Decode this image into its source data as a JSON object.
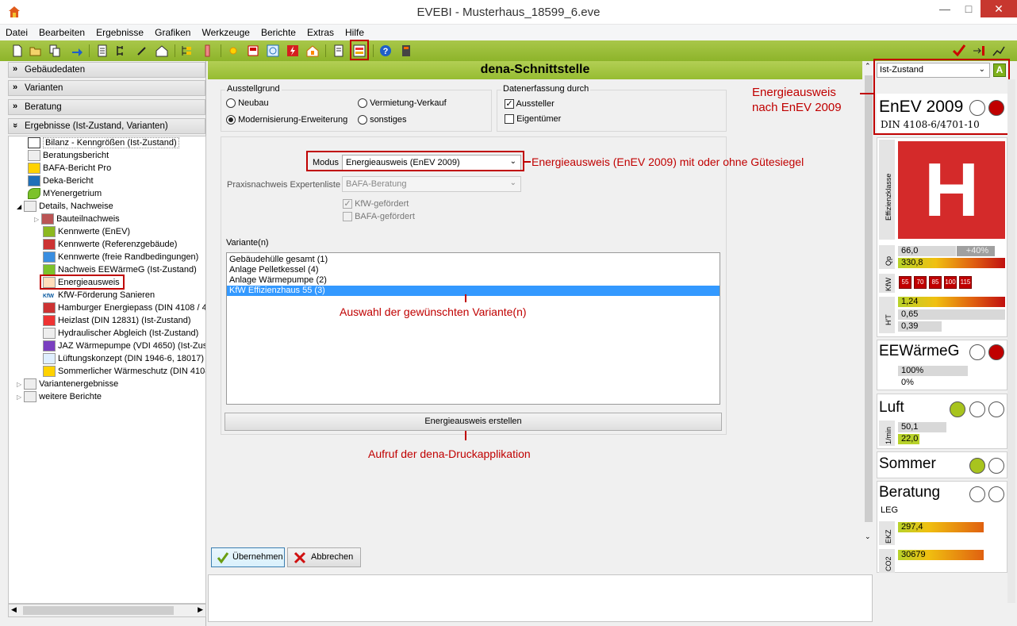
{
  "window": {
    "title": "EVEBI - Musterhaus_18599_6.eve"
  },
  "menu": [
    "Datei",
    "Bearbeiten",
    "Ergebnisse",
    "Grafiken",
    "Werkzeuge",
    "Berichte",
    "Extras",
    "Hilfe"
  ],
  "accordion": [
    {
      "label": "Gebäudedaten",
      "chev": "»"
    },
    {
      "label": "Varianten",
      "chev": "»"
    },
    {
      "label": "Beratung",
      "chev": "»"
    },
    {
      "label": "Ergebnisse (Ist-Zustand, Varianten)",
      "chev": "»"
    }
  ],
  "tree": [
    {
      "label": "Bilanz - Kenngrößen (Ist-Zustand)"
    },
    {
      "label": "Beratungsbericht"
    },
    {
      "label": "BAFA-Bericht Pro"
    },
    {
      "label": "Deka-Bericht"
    },
    {
      "label": "MYenergetrium"
    },
    {
      "label": "Details, Nachweise"
    },
    {
      "label": "Bauteilnachweis"
    },
    {
      "label": "Kennwerte (EnEV)"
    },
    {
      "label": "Kennwerte (Referenzgebäude)"
    },
    {
      "label": "Kennwerte (freie Randbedingungen)"
    },
    {
      "label": "Nachweis EEWärmeG (Ist-Zustand)"
    },
    {
      "label": "Energieausweis"
    },
    {
      "label": "KfW-Förderung Sanieren"
    },
    {
      "label": "Hamburger Energiepass (DIN 4108 / 4"
    },
    {
      "label": "Heizlast (DIN 12831) (Ist-Zustand)"
    },
    {
      "label": "Hydraulischer Abgleich (Ist-Zustand)"
    },
    {
      "label": "JAZ Wärmepumpe (VDI 4650) (Ist-Zus"
    },
    {
      "label": "Lüftungskonzept (DIN 1946-6, 18017)"
    },
    {
      "label": "Sommerlicher Wärmeschutz (DIN 4108"
    },
    {
      "label": "Variantenergebnisse"
    },
    {
      "label": "weitere Berichte"
    }
  ],
  "center": {
    "title": "dena-Schnittstelle",
    "ausstellgrund": {
      "label": "Ausstellgrund",
      "options": [
        "Neubau",
        "Vermietung-Verkauf",
        "Modernisierung-Erweiterung",
        "sonstiges"
      ],
      "selected": "Modernisierung-Erweiterung"
    },
    "datenerfassung": {
      "label": "Datenerfassung durch",
      "options": [
        {
          "label": "Aussteller",
          "checked": true
        },
        {
          "label": "Eigentümer",
          "checked": false
        }
      ]
    },
    "modus": {
      "label": "Modus",
      "value": "Energieausweis (EnEV 2009)"
    },
    "praxis": {
      "label": "Praxisnachweis Expertenliste",
      "value": "BAFA-Beratung"
    },
    "kfw_gefoerdert": "KfW-gefördert",
    "bafa_gefoerdert": "BAFA-gefördert",
    "varianten_label": "Variante(n)",
    "varianten": [
      "Gebäudehülle gesamt (1)",
      "Anlage Pelletkessel (4)",
      "Anlage Wärmepumpe (2)",
      "KfW Effizienzhaus 55 (3)"
    ],
    "selected_variant": "KfW Effizienzhaus 55 (3)",
    "create_button": "Energieausweis erstellen",
    "ok_button": "Übernehmen",
    "cancel_button": "Abbrechen"
  },
  "annotations": {
    "modus": "Energieausweis (EnEV 2009) mit oder ohne Gütesiegel",
    "variante": "Auswahl der gewünschten Variante(n)",
    "druck": "Aufruf der dena-Druckapplikation",
    "enev_line1": "Energieausweis",
    "enev_line2": "nach EnEV 2009"
  },
  "right": {
    "state_select": "Ist-Zustand",
    "state_badge": "A",
    "enev_title": "EnEV 2009",
    "enev_sub": "DIN 4108-6/4701-10",
    "effizienzklasse_label": "Effizienzklasse",
    "effizienzklasse": "H",
    "qp_label": "Qp",
    "qp_values": [
      "66,0",
      "+40%",
      "330,8"
    ],
    "kfw_label": "KfW",
    "kfw_levels": [
      "55",
      "70",
      "85",
      "100",
      "115"
    ],
    "ht_label": "H'T",
    "ht_values": [
      "1,24",
      "0,65",
      "0,39"
    ],
    "eewg_title": "EEWärmeG",
    "eewg_values": [
      "100%",
      "0%"
    ],
    "luft_title": "Luft",
    "luft_label": "1/min",
    "luft_values": [
      "50,1",
      "22,0"
    ],
    "sommer_title": "Sommer",
    "beratung_title": "Beratung",
    "beratung_sub": "LEG",
    "ekz_label": "EKZ",
    "ekz_value": "297,4",
    "co2_label": "CO2",
    "co2_value": "30679"
  },
  "colors": {
    "toolbar_green": "#96bc31",
    "highlight_red": "#c00000",
    "selection_blue": "#3399ff",
    "class_h_red": "#d42a2a"
  }
}
